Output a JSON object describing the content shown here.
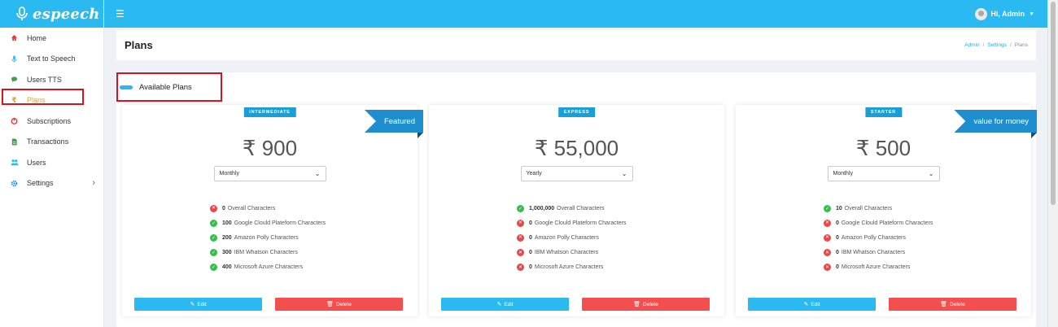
{
  "brand": {
    "name": "espeech"
  },
  "sidebar": {
    "items": [
      {
        "label": "Home",
        "icon": "home-icon",
        "color": "#e53935"
      },
      {
        "label": "Text to Speech",
        "icon": "microphone-icon",
        "color": "#2ab9f0"
      },
      {
        "label": "Users TTS",
        "icon": "chat-icon",
        "color": "#43a047"
      },
      {
        "label": "Plans",
        "icon": "rupee-icon",
        "color": "#e8a300",
        "active": true
      },
      {
        "label": "Subscriptions",
        "icon": "power-icon",
        "color": "#e53935"
      },
      {
        "label": "Transactions",
        "icon": "document-icon",
        "color": "#43a047"
      },
      {
        "label": "Users",
        "icon": "users-icon",
        "color": "#2ab9f0"
      },
      {
        "label": "Settings",
        "icon": "gear-icon",
        "color": "#1e88e5"
      }
    ]
  },
  "topbar": {
    "user_greeting": "Hi, Admin"
  },
  "page": {
    "title": "Plans",
    "breadcrumb": [
      "Admin",
      "Settings",
      "Plans"
    ],
    "section_title": "Available Plans"
  },
  "plans": [
    {
      "tier": "INTERMEDIATE",
      "price": "₹ 900",
      "period": "Monthly",
      "ribbon": "Featured",
      "features": [
        {
          "value": "0",
          "label": "Overall Characters",
          "included": false
        },
        {
          "value": "100",
          "label": "Google Clould Plateform Characters",
          "included": true
        },
        {
          "value": "200",
          "label": "Amazon Polly Characters",
          "included": true
        },
        {
          "value": "300",
          "label": "IBM Whatson Characters",
          "included": true
        },
        {
          "value": "400",
          "label": "Microsoft Azure Characters",
          "included": true
        }
      ],
      "edit_label": "Edit",
      "delete_label": "Delete"
    },
    {
      "tier": "EXPRESS",
      "price": "₹ 55,000",
      "period": "Yearly",
      "ribbon": "",
      "features": [
        {
          "value": "1,000,000",
          "label": "Overall Characters",
          "included": true
        },
        {
          "value": "0",
          "label": "Google Clould Plateform Characters",
          "included": false
        },
        {
          "value": "0",
          "label": "Amazon Polly Characters",
          "included": false
        },
        {
          "value": "0",
          "label": "IBM Whatson Characters",
          "included": false
        },
        {
          "value": "0",
          "label": "Microsoft Azure Characters",
          "included": false
        }
      ],
      "edit_label": "Edit",
      "delete_label": "Delete"
    },
    {
      "tier": "STARTER",
      "price": "₹ 500",
      "period": "Monthly",
      "ribbon": "value for money",
      "features": [
        {
          "value": "10",
          "label": "Overall Characters",
          "included": true
        },
        {
          "value": "0",
          "label": "Google Clould Plateform Characters",
          "included": false
        },
        {
          "value": "0",
          "label": "Amazon Polly Characters",
          "included": false
        },
        {
          "value": "0",
          "label": "IBM Whatson Characters",
          "included": false
        },
        {
          "value": "0",
          "label": "Microsoft Azure Characters",
          "included": false
        }
      ],
      "edit_label": "Edit",
      "delete_label": "Delete"
    }
  ],
  "colors": {
    "primary": "#2ab9f0",
    "ribbon": "#1e8ed0",
    "tier_badge": "#189fd8",
    "danger": "#f34f4f",
    "success": "#34bf49",
    "highlight": "#d9121f"
  }
}
